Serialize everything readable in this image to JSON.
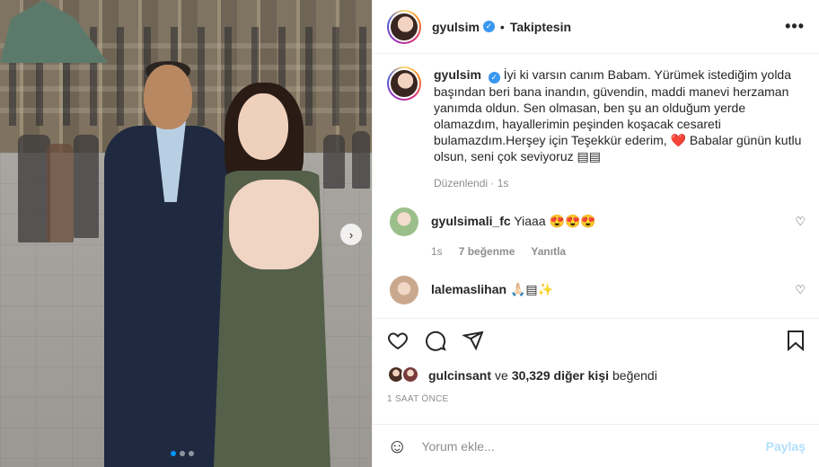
{
  "header": {
    "username": "gyulsim",
    "separator": "•",
    "follow_status": "Takiptesin",
    "more": "•••"
  },
  "caption": {
    "username": "gyulsim",
    "text": "İyi ki varsın canım Babam. Yürümek istediğim yolda başından beri bana inandın, güvendin, maddi manevi herzaman yanımda oldun. Sen olmasan, ben şu an olduğum yerde olamazdım, hayallerimin peşinden koşacak cesareti bulamazdım.Herşey için Teşekkür ederim,",
    "heart": "❤️",
    "text_end": "Babalar günün kutlu olsun, seni çok seviyoruz",
    "flags": "▤▤",
    "meta": "Düzenlendi · 1s"
  },
  "comments": [
    {
      "username": "gyulsimali_fc",
      "text": "Yiaaa 😍😍😍",
      "time": "1s",
      "likes": "7 beğenme",
      "reply": "Yanıtla",
      "avatar_color": "#9bbf8a"
    },
    {
      "username": "lalemaslihan",
      "text": "🙏🏻▤✨",
      "avatar_color": "#c9a88d"
    }
  ],
  "likes": {
    "first_user": "gulcinsant",
    "connector": "ve",
    "others": "30,329 diğer kişi",
    "suffix": "beğendi"
  },
  "posted_ago": "1 SAAT ÖNCE",
  "add_comment": {
    "placeholder": "Yorum ekle...",
    "post_label": "Paylaş"
  },
  "carousel": {
    "next": "›",
    "total_slides": 3,
    "active_slide": 1
  },
  "colors": {
    "verified": "#3897f0",
    "carousel_active": "#0095f6",
    "post_button": "#b2dffc"
  }
}
